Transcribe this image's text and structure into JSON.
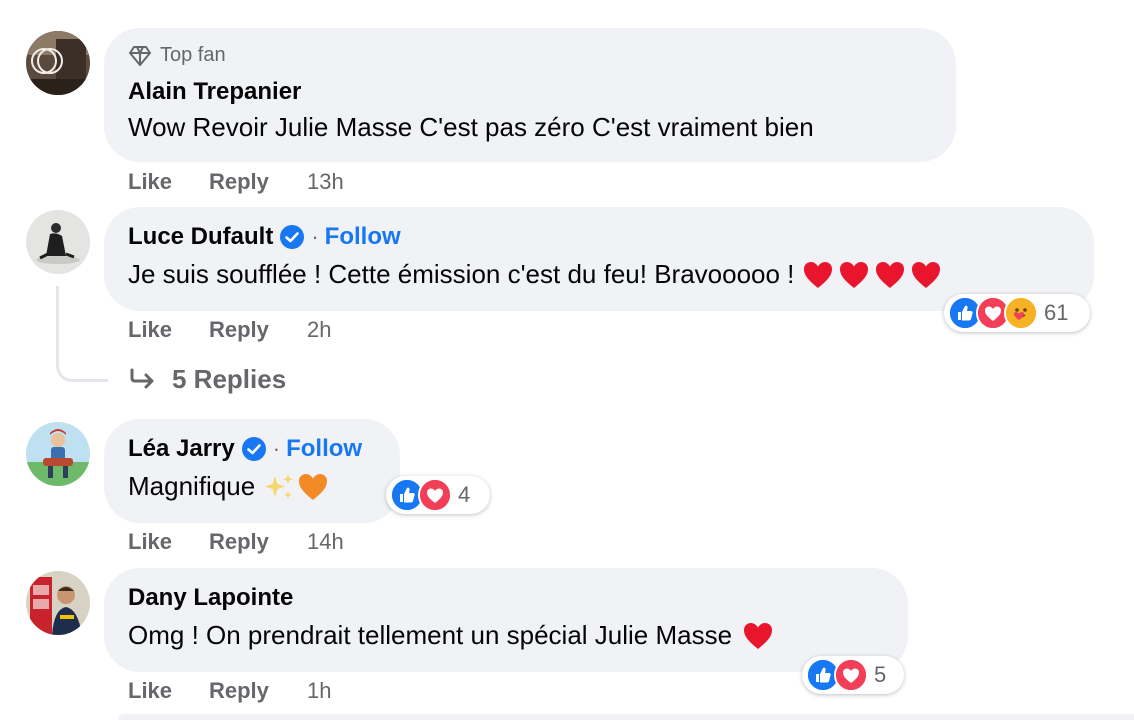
{
  "comments": [
    {
      "badge": "Top fan",
      "author": "Alain Trepanier",
      "text": "Wow Revoir Julie Masse C'est pas zéro C'est vraiment bien",
      "like": "Like",
      "reply": "Reply",
      "time": "13h"
    },
    {
      "author": "Luce Dufault",
      "follow": "Follow",
      "text": "Je suis soufflée ! Cette émission c'est du feu! Bravooooo !",
      "emojis": [
        "red-heart",
        "red-heart",
        "red-heart",
        "red-heart"
      ],
      "reactions": [
        "like",
        "love",
        "care"
      ],
      "reaction_count": "61",
      "like": "Like",
      "reply": "Reply",
      "time": "2h",
      "replies_label": "5 Replies"
    },
    {
      "author": "Léa Jarry",
      "follow": "Follow",
      "text": "Magnifique",
      "emojis": [
        "sparkles",
        "orange-heart"
      ],
      "reactions": [
        "like",
        "love"
      ],
      "reaction_count": "4",
      "like": "Like",
      "reply": "Reply",
      "time": "14h"
    },
    {
      "author": "Dany Lapointe",
      "text": "Omg ! On prendrait tellement un spécial Julie Masse",
      "emojis": [
        "red-heart"
      ],
      "reactions": [
        "like",
        "love"
      ],
      "reaction_count": "5",
      "like": "Like",
      "reply": "Reply",
      "time": "1h"
    }
  ],
  "separator": "·",
  "colors": {
    "bubble": "#f0f2f5",
    "link": "#1877f2",
    "meta": "#65676b",
    "love": "#f33e58",
    "like": "#1877f2",
    "care": "#f7b125"
  }
}
